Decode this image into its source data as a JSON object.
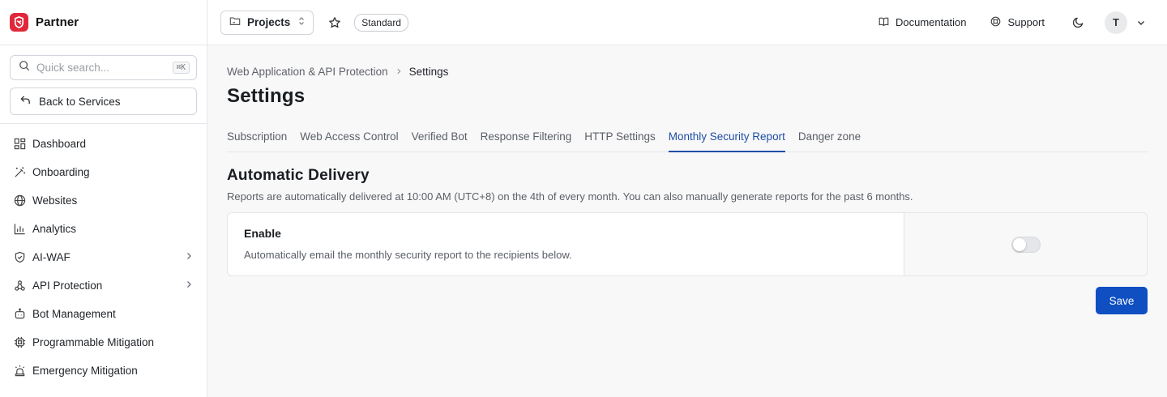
{
  "brand": {
    "name": "Partner",
    "logo_color": "#e0283a"
  },
  "sidebar": {
    "search": {
      "placeholder": "Quick search...",
      "shortcut": "⌘K"
    },
    "back_label": "Back to Services",
    "items": [
      {
        "label": "Dashboard",
        "icon": "dashboard-icon",
        "has_submenu": false
      },
      {
        "label": "Onboarding",
        "icon": "magic-wand-icon",
        "has_submenu": false
      },
      {
        "label": "Websites",
        "icon": "globe-icon",
        "has_submenu": false
      },
      {
        "label": "Analytics",
        "icon": "bar-chart-icon",
        "has_submenu": false
      },
      {
        "label": "AI-WAF",
        "icon": "shield-check-icon",
        "has_submenu": true
      },
      {
        "label": "API Protection",
        "icon": "webhook-icon",
        "has_submenu": true
      },
      {
        "label": "Bot Management",
        "icon": "bot-icon",
        "has_submenu": false
      },
      {
        "label": "Programmable Mitigation",
        "icon": "chip-icon",
        "has_submenu": false
      },
      {
        "label": "Emergency Mitigation",
        "icon": "siren-icon",
        "has_submenu": false
      }
    ]
  },
  "header": {
    "project_label": "Projects",
    "plan_badge": "Standard",
    "documentation_label": "Documentation",
    "support_label": "Support",
    "avatar_initial": "T"
  },
  "main": {
    "breadcrumb": {
      "parent": "Web Application & API Protection",
      "current": "Settings"
    },
    "title": "Settings",
    "tabs": [
      {
        "label": "Subscription",
        "active": false
      },
      {
        "label": "Web Access Control",
        "active": false
      },
      {
        "label": "Verified Bot",
        "active": false
      },
      {
        "label": "Response Filtering",
        "active": false
      },
      {
        "label": "HTTP Settings",
        "active": false
      },
      {
        "label": "Monthly Security Report",
        "active": true
      },
      {
        "label": "Danger zone",
        "active": false
      }
    ],
    "section": {
      "title": "Automatic Delivery",
      "description": "Reports are automatically delivered at 10:00 AM (UTC+8) on the 4th of every month. You can also manually generate reports for the past 6 months."
    },
    "enable_card": {
      "label": "Enable",
      "description": "Automatically email the monthly security report to the recipients below.",
      "toggle_on": false
    },
    "save_label": "Save"
  },
  "colors": {
    "accent": "#1e4ea3",
    "primary_button": "#0f4fc2"
  }
}
